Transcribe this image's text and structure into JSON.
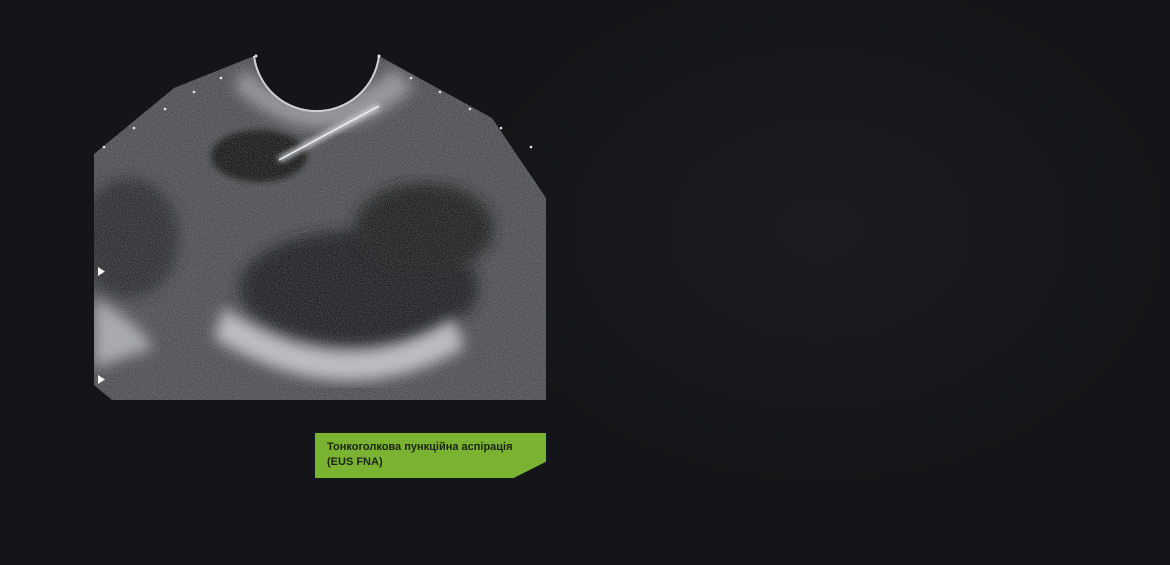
{
  "caption": {
    "line1": "Тонкоголкова пункційна аспірація",
    "line2": "(EUS FNA)"
  },
  "colors": {
    "background": "#141518",
    "caption_bg": "#79b331",
    "caption_text": "#1d2410"
  }
}
